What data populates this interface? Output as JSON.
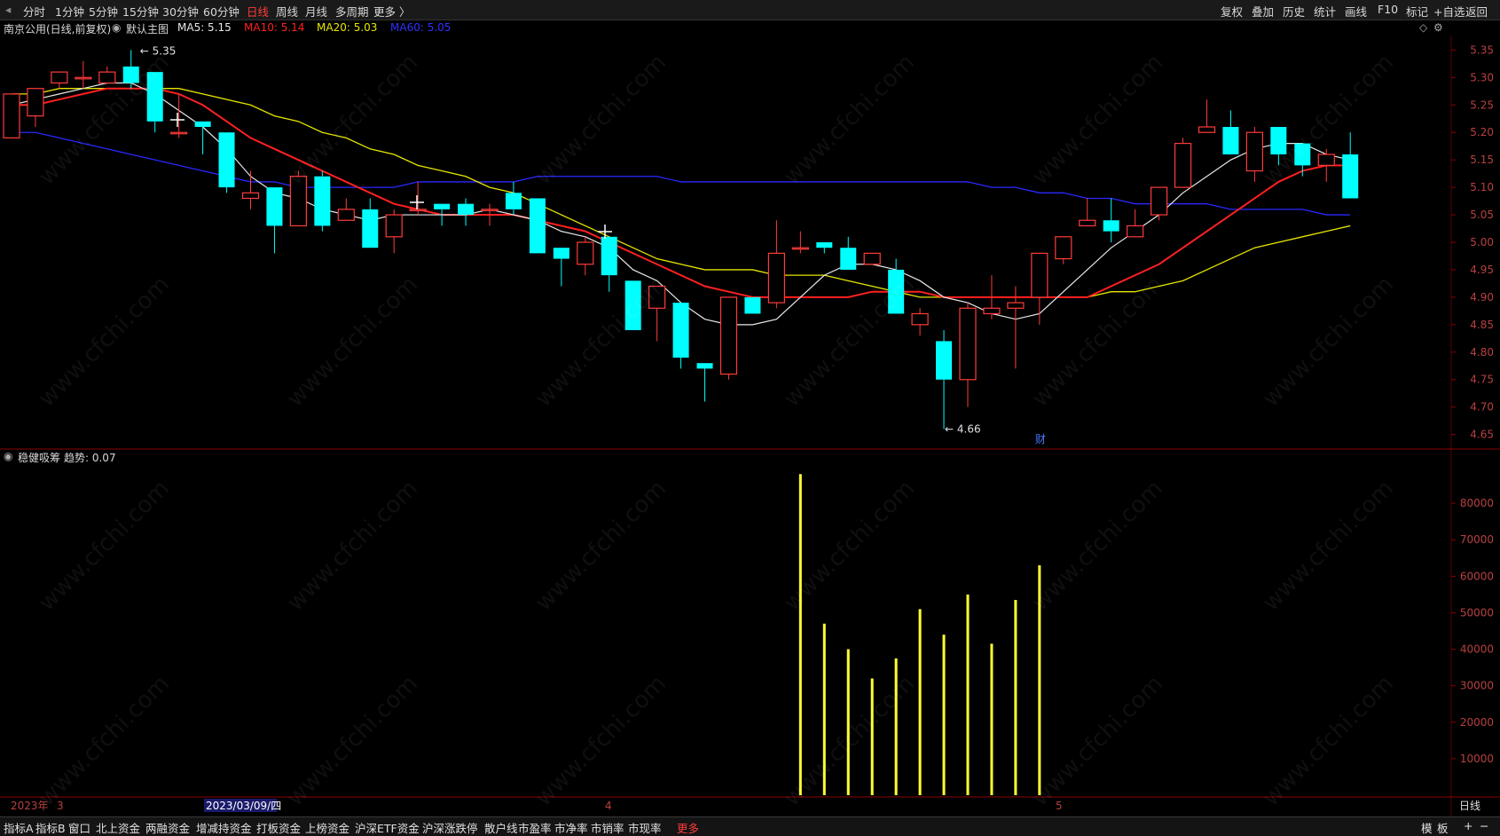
{
  "toolbar": {
    "periods": [
      "分时",
      "1分钟",
      "5分钟",
      "15分钟",
      "30分钟",
      "60分钟",
      "日线",
      "周线",
      "月线",
      "多周期",
      "更多 〉"
    ],
    "active_period": "日线",
    "right": [
      "复权",
      "叠加",
      "历史",
      "统计",
      "画线",
      "F10",
      "标记",
      "+自选",
      "返回"
    ]
  },
  "info": {
    "title": "南京公用(日线,前复权)",
    "main_label": "默认主图",
    "ma5": "MA5: 5.15",
    "ma10": "MA10: 5.14",
    "ma20": "MA20: 5.03",
    "ma60": "MA60: 5.05"
  },
  "colors": {
    "up": "#ff3b3b",
    "down": "#00ffff",
    "ma5": "#e8e8e8",
    "ma10": "#ff2020",
    "ma20": "#e6e600",
    "ma60": "#2828ff",
    "indicator": "#ffff33",
    "grid": "#5a0000"
  },
  "price_axis": [
    "5.35",
    "5.30",
    "5.25",
    "5.20",
    "5.15",
    "5.10",
    "5.05",
    "5.00",
    "4.95",
    "4.90",
    "4.85",
    "4.80",
    "4.75",
    "4.70",
    "4.65"
  ],
  "annotations": {
    "high": "5.35",
    "low": "4.66",
    "fin": "财"
  },
  "indicator": {
    "name": "稳健吸筹",
    "trend": "趋势: 0.07",
    "axis": [
      "80000",
      "70000",
      "60000",
      "50000",
      "40000",
      "30000",
      "20000",
      "10000"
    ]
  },
  "date_axis": {
    "year": "2023年",
    "m3": "3",
    "cursor_date": "2023/03/09/四",
    "m4": "4",
    "m5": "5",
    "period_label": "日线"
  },
  "bottom_tabs": [
    "指标A",
    "指标B",
    "窗口",
    "北上资金",
    "两融资金",
    "增减持资金",
    "打板资金",
    "上榜资金",
    "沪深ETF资金",
    "沪深涨跌停",
    "散户线",
    "市盈率",
    "市净率",
    "市销率",
    "市现率",
    "更多"
  ],
  "bottom_right": [
    "模",
    "板",
    "+",
    "−"
  ],
  "watermark": "www.cfchi.com",
  "chart_data": {
    "type": "candlestick",
    "ylim": [
      4.63,
      5.37
    ],
    "candles": [
      {
        "o": 5.19,
        "c": 5.27,
        "h": 5.27,
        "l": 5.19
      },
      {
        "o": 5.23,
        "c": 5.28,
        "h": 5.28,
        "l": 5.21
      },
      {
        "o": 5.29,
        "c": 5.31,
        "h": 5.31,
        "l": 5.28
      },
      {
        "o": 5.3,
        "c": 5.3,
        "h": 5.33,
        "l": 5.28
      },
      {
        "o": 5.29,
        "c": 5.31,
        "h": 5.32,
        "l": 5.29
      },
      {
        "o": 5.32,
        "c": 5.29,
        "h": 5.35,
        "l": 5.28
      },
      {
        "o": 5.31,
        "c": 5.22,
        "h": 5.31,
        "l": 5.2
      },
      {
        "o": 5.2,
        "c": 5.2,
        "h": 5.27,
        "l": 5.19
      },
      {
        "o": 5.22,
        "c": 5.21,
        "h": 5.22,
        "l": 5.16
      },
      {
        "o": 5.2,
        "c": 5.1,
        "h": 5.2,
        "l": 5.09
      },
      {
        "o": 5.08,
        "c": 5.09,
        "h": 5.13,
        "l": 5.06
      },
      {
        "o": 5.1,
        "c": 5.03,
        "h": 5.1,
        "l": 4.98
      },
      {
        "o": 5.03,
        "c": 5.12,
        "h": 5.13,
        "l": 5.03
      },
      {
        "o": 5.12,
        "c": 5.03,
        "h": 5.13,
        "l": 5.02
      },
      {
        "o": 5.04,
        "c": 5.06,
        "h": 5.08,
        "l": 5.04
      },
      {
        "o": 5.06,
        "c": 4.99,
        "h": 5.08,
        "l": 4.99
      },
      {
        "o": 5.01,
        "c": 5.05,
        "h": 5.06,
        "l": 4.98
      },
      {
        "o": 5.06,
        "c": 5.06,
        "h": 5.11,
        "l": 5.05
      },
      {
        "o": 5.07,
        "c": 5.06,
        "h": 5.07,
        "l": 5.03
      },
      {
        "o": 5.07,
        "c": 5.05,
        "h": 5.08,
        "l": 5.03
      },
      {
        "o": 5.06,
        "c": 5.06,
        "h": 5.07,
        "l": 5.03
      },
      {
        "o": 5.09,
        "c": 5.06,
        "h": 5.11,
        "l": 5.05
      },
      {
        "o": 5.08,
        "c": 4.98,
        "h": 5.08,
        "l": 4.98
      },
      {
        "o": 4.99,
        "c": 4.97,
        "h": 4.99,
        "l": 4.92
      },
      {
        "o": 4.96,
        "c": 5.0,
        "h": 5.01,
        "l": 4.94
      },
      {
        "o": 5.01,
        "c": 4.94,
        "h": 5.01,
        "l": 4.91
      },
      {
        "o": 4.93,
        "c": 4.84,
        "h": 4.93,
        "l": 4.84
      },
      {
        "o": 4.88,
        "c": 4.92,
        "h": 4.92,
        "l": 4.82
      },
      {
        "o": 4.89,
        "c": 4.79,
        "h": 4.89,
        "l": 4.77
      },
      {
        "o": 4.78,
        "c": 4.77,
        "h": 4.78,
        "l": 4.71
      },
      {
        "o": 4.76,
        "c": 4.9,
        "h": 4.9,
        "l": 4.75
      },
      {
        "o": 4.9,
        "c": 4.87,
        "h": 4.9,
        "l": 4.87
      },
      {
        "o": 4.89,
        "c": 4.98,
        "h": 5.04,
        "l": 4.88
      },
      {
        "o": 4.99,
        "c": 4.99,
        "h": 5.02,
        "l": 4.98
      },
      {
        "o": 5.0,
        "c": 4.99,
        "h": 5.0,
        "l": 4.98
      },
      {
        "o": 4.99,
        "c": 4.95,
        "h": 5.01,
        "l": 4.95
      },
      {
        "o": 4.96,
        "c": 4.98,
        "h": 4.98,
        "l": 4.96
      },
      {
        "o": 4.95,
        "c": 4.87,
        "h": 4.97,
        "l": 4.87
      },
      {
        "o": 4.85,
        "c": 4.87,
        "h": 4.88,
        "l": 4.83
      },
      {
        "o": 4.82,
        "c": 4.75,
        "h": 4.84,
        "l": 4.66
      },
      {
        "o": 4.75,
        "c": 4.88,
        "h": 4.89,
        "l": 4.7
      },
      {
        "o": 4.87,
        "c": 4.88,
        "h": 4.94,
        "l": 4.86
      },
      {
        "o": 4.88,
        "c": 4.89,
        "h": 4.92,
        "l": 4.77
      },
      {
        "o": 4.9,
        "c": 4.98,
        "h": 4.98,
        "l": 4.85
      },
      {
        "o": 4.97,
        "c": 5.01,
        "h": 5.01,
        "l": 4.96
      },
      {
        "o": 5.03,
        "c": 5.04,
        "h": 5.08,
        "l": 5.03
      },
      {
        "o": 5.04,
        "c": 5.02,
        "h": 5.08,
        "l": 5.0
      },
      {
        "o": 5.01,
        "c": 5.03,
        "h": 5.06,
        "l": 5.01
      },
      {
        "o": 5.05,
        "c": 5.1,
        "h": 5.1,
        "l": 5.04
      },
      {
        "o": 5.1,
        "c": 5.18,
        "h": 5.19,
        "l": 5.1
      },
      {
        "o": 5.2,
        "c": 5.21,
        "h": 5.26,
        "l": 5.2
      },
      {
        "o": 5.21,
        "c": 5.16,
        "h": 5.24,
        "l": 5.16
      },
      {
        "o": 5.13,
        "c": 5.2,
        "h": 5.21,
        "l": 5.11
      },
      {
        "o": 5.21,
        "c": 5.16,
        "h": 5.21,
        "l": 5.14
      },
      {
        "o": 5.18,
        "c": 5.14,
        "h": 5.18,
        "l": 5.12
      },
      {
        "o": 5.14,
        "c": 5.16,
        "h": 5.17,
        "l": 5.11
      },
      {
        "o": 5.16,
        "c": 5.08,
        "h": 5.2,
        "l": 5.08
      }
    ],
    "ma5": [
      5.25,
      5.26,
      5.27,
      5.28,
      5.29,
      5.29,
      5.27,
      5.24,
      5.21,
      5.17,
      5.12,
      5.09,
      5.08,
      5.06,
      5.05,
      5.04,
      5.05,
      5.05,
      5.05,
      5.05,
      5.06,
      5.05,
      5.04,
      5.02,
      5.01,
      4.99,
      4.95,
      4.93,
      4.89,
      4.86,
      4.85,
      4.85,
      4.86,
      4.9,
      4.94,
      4.96,
      4.96,
      4.95,
      4.93,
      4.9,
      4.89,
      4.87,
      4.86,
      4.87,
      4.91,
      4.95,
      4.99,
      5.02,
      5.05,
      5.09,
      5.12,
      5.15,
      5.17,
      5.18,
      5.18,
      5.16,
      5.15
    ],
    "ma10": [
      5.25,
      5.25,
      5.26,
      5.27,
      5.28,
      5.28,
      5.28,
      5.27,
      5.25,
      5.22,
      5.19,
      5.17,
      5.15,
      5.13,
      5.11,
      5.09,
      5.07,
      5.06,
      5.05,
      5.05,
      5.05,
      5.05,
      5.04,
      5.03,
      5.02,
      5.0,
      4.98,
      4.96,
      4.94,
      4.92,
      4.91,
      4.9,
      4.9,
      4.9,
      4.9,
      4.9,
      4.91,
      4.91,
      4.91,
      4.9,
      4.9,
      4.9,
      4.9,
      4.9,
      4.9,
      4.9,
      4.92,
      4.94,
      4.96,
      4.99,
      5.02,
      5.05,
      5.08,
      5.11,
      5.13,
      5.14,
      5.14
    ],
    "ma20": [
      5.27,
      5.27,
      5.28,
      5.28,
      5.28,
      5.28,
      5.28,
      5.28,
      5.27,
      5.26,
      5.25,
      5.23,
      5.22,
      5.2,
      5.19,
      5.17,
      5.16,
      5.14,
      5.13,
      5.12,
      5.1,
      5.09,
      5.07,
      5.05,
      5.03,
      5.01,
      4.99,
      4.97,
      4.96,
      4.95,
      4.95,
      4.95,
      4.94,
      4.94,
      4.94,
      4.93,
      4.92,
      4.91,
      4.9,
      4.9,
      4.9,
      4.9,
      4.9,
      4.9,
      4.9,
      4.9,
      4.91,
      4.91,
      4.92,
      4.93,
      4.95,
      4.97,
      4.99,
      5.0,
      5.01,
      5.02,
      5.03
    ],
    "ma60": [
      5.2,
      5.2,
      5.19,
      5.18,
      5.17,
      5.16,
      5.15,
      5.14,
      5.13,
      5.12,
      5.11,
      5.11,
      5.1,
      5.1,
      5.1,
      5.1,
      5.1,
      5.11,
      5.11,
      5.11,
      5.11,
      5.11,
      5.12,
      5.12,
      5.12,
      5.12,
      5.12,
      5.12,
      5.11,
      5.11,
      5.11,
      5.11,
      5.11,
      5.11,
      5.11,
      5.11,
      5.11,
      5.11,
      5.11,
      5.11,
      5.11,
      5.1,
      5.1,
      5.09,
      5.09,
      5.08,
      5.08,
      5.07,
      5.07,
      5.07,
      5.07,
      5.06,
      5.06,
      5.06,
      5.06,
      5.05,
      5.05
    ],
    "indicator_values": {
      "33": 88000,
      "34": 47000,
      "35": 40000,
      "36": 32000,
      "37": 37500,
      "38": 51000,
      "39": 44000,
      "40": 55000,
      "41": 41500,
      "42": 53500,
      "43": 63000
    },
    "indicator_ylim": [
      0,
      90000
    ]
  }
}
